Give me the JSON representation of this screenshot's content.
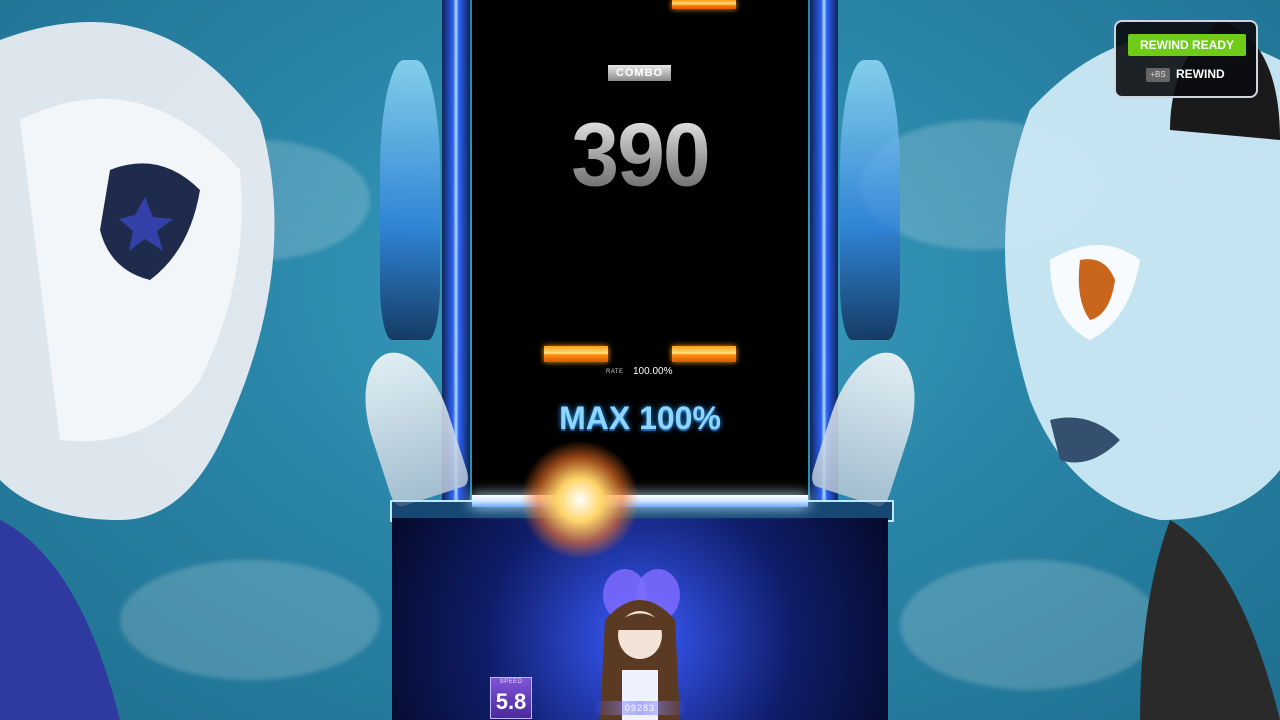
{
  "hud": {
    "combo_label": "COMBO",
    "combo_value": "390",
    "rate_label": "RATE",
    "rate_value": "100.00%",
    "max_rate_text": "MAX 100%",
    "speed_label": "SPEED",
    "speed_value": "5.8",
    "score": "09283"
  },
  "rewind": {
    "ready_label": "REWIND READY",
    "key_label": "+BS",
    "action_label": "REWIND"
  },
  "colors": {
    "note": "#ff9a1f",
    "rewind_ready": "#6ecb17",
    "max_rate": "#8fd6ff",
    "lane": "#000000"
  },
  "icons": [
    "backspace-key-icon"
  ]
}
